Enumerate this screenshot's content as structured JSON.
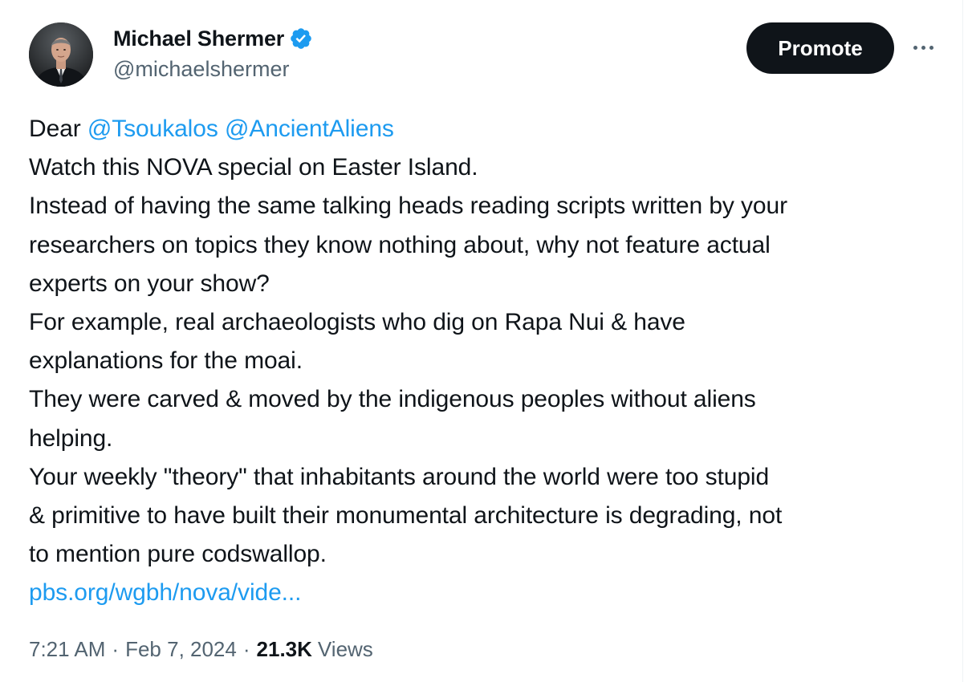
{
  "author": {
    "display_name": "Michael Shermer",
    "handle": "@michaelshermer",
    "verified": true,
    "avatar": "profile-photo"
  },
  "header": {
    "promote_label": "Promote",
    "more_icon": "more-horizontal-icon"
  },
  "tweet": {
    "greeting": "Dear",
    "mentions": [
      "@Tsoukalos",
      "@AncientAliens"
    ],
    "lines": [
      "Watch this NOVA special on Easter Island.",
      "Instead of having the same talking heads reading scripts written by your",
      "researchers on topics they know nothing about, why not feature actual",
      "experts on your show?",
      "For example, real archaeologists who dig on Rapa Nui & have",
      "explanations for the moai.",
      "They were carved & moved by the indigenous peoples without aliens",
      "helping.",
      "Your weekly \"theory\" that inhabitants around the world were too stupid",
      "& primitive to have built their monumental architecture is degrading, not",
      "to mention pure codswallop."
    ],
    "link": "pbs.org/wgbh/nova/vide..."
  },
  "meta": {
    "time": "7:21 AM",
    "separator": "·",
    "date": "Feb 7, 2024",
    "views_count": "21.3K",
    "views_label": "Views"
  },
  "colors": {
    "text": "#0f1419",
    "secondary": "#536471",
    "accent": "#1d9bf0",
    "button_bg": "#0f1419"
  }
}
